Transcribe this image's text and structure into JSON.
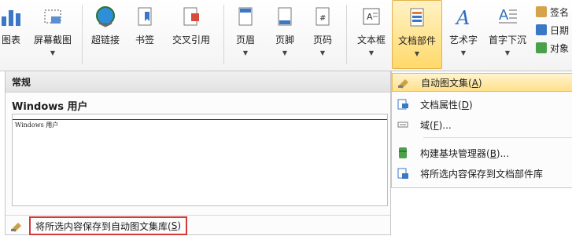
{
  "ribbon": {
    "buttons": [
      {
        "label": "图表",
        "icon": "chart-icon",
        "has_dropdown": false
      },
      {
        "label": "屏幕截图",
        "icon": "screenshot-icon",
        "has_dropdown": true
      },
      {
        "label": "超链接",
        "icon": "hyperlink-icon",
        "has_dropdown": false
      },
      {
        "label": "书签",
        "icon": "bookmark-icon",
        "has_dropdown": false
      },
      {
        "label": "交叉引用",
        "icon": "cross-reference-icon",
        "has_dropdown": false
      },
      {
        "label": "页眉",
        "icon": "header-icon",
        "has_dropdown": true
      },
      {
        "label": "页脚",
        "icon": "footer-icon",
        "has_dropdown": true
      },
      {
        "label": "页码",
        "icon": "page-number-icon",
        "has_dropdown": true
      },
      {
        "label": "文本框",
        "icon": "text-box-icon",
        "has_dropdown": true
      },
      {
        "label": "文档部件",
        "icon": "quick-parts-icon",
        "has_dropdown": true,
        "active": true
      },
      {
        "label": "艺术字",
        "icon": "wordart-icon",
        "has_dropdown": true
      },
      {
        "label": "首字下沉",
        "icon": "drop-cap-icon",
        "has_dropdown": true
      }
    ],
    "side_items": [
      {
        "label": "签名",
        "icon": "signature-icon"
      },
      {
        "label": "日期",
        "icon": "date-time-icon"
      },
      {
        "label": "对象",
        "icon": "object-icon"
      }
    ]
  },
  "autotext_panel": {
    "section_header": "常规",
    "entry_name": "Windows 用户",
    "preview_text": "Windows 用户",
    "save_action": {
      "text": "将所选内容保存到自动图文集库(",
      "accel": "S",
      "suffix": ")"
    }
  },
  "menu": {
    "items": [
      {
        "text": "自动图文集(",
        "accel": "A",
        "suffix": ")",
        "icon": "autotext-icon",
        "active": true
      },
      {
        "text": "文档属性(",
        "accel": "D",
        "suffix": ")",
        "icon": "document-property-icon"
      },
      {
        "text": "域(",
        "accel": "F",
        "suffix": ")...",
        "icon": "field-icon"
      },
      {
        "text": "构建基块管理器(",
        "accel": "B",
        "suffix": ")...",
        "icon": "building-blocks-icon"
      },
      {
        "text": "将所选内容保存到文档部件库",
        "accel": "",
        "suffix": "",
        "icon": "save-to-gallery-icon"
      }
    ]
  },
  "colors": {
    "highlight_border": "#d33a3a",
    "active_gold": "#ffd96a"
  }
}
